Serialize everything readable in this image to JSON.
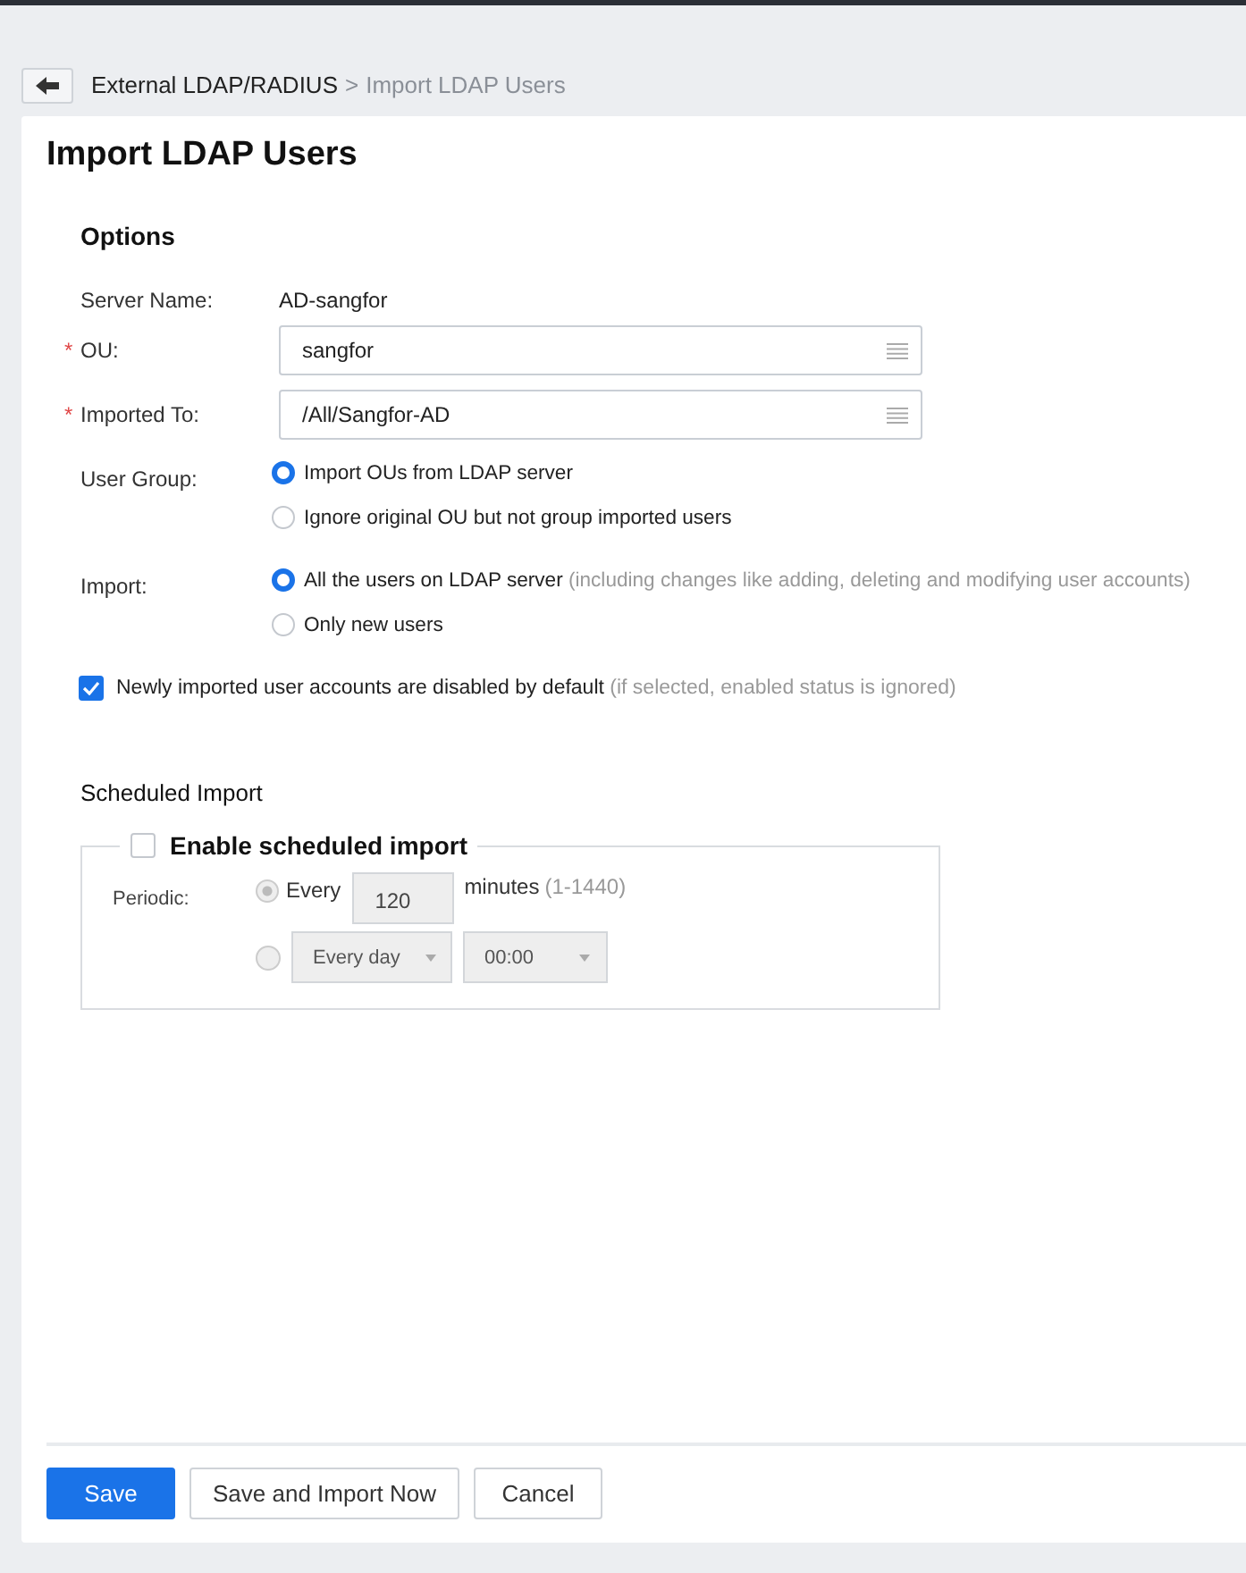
{
  "breadcrumb": {
    "parent": "External LDAP/RADIUS",
    "separator": ">",
    "current": "Import LDAP Users"
  },
  "title": "Import LDAP Users",
  "options": {
    "heading": "Options",
    "rows": [
      {
        "kind": "text",
        "label": "Server Name:",
        "value": "AD-sangfor"
      },
      {
        "kind": "picker",
        "label": "OU:",
        "required_mark": "*",
        "value": "sangfor"
      },
      {
        "kind": "picker",
        "label": "Imported To:",
        "required_mark": "*",
        "value": "/All/Sangfor-AD"
      },
      {
        "kind": "radio",
        "label": "User Group:",
        "options": [
          {
            "label": "Import OUs from LDAP server",
            "selected": true
          },
          {
            "label": "Ignore original OU but not group imported users",
            "selected": false
          }
        ]
      },
      {
        "kind": "radio",
        "label": "Import:",
        "options": [
          {
            "label": "All the users on LDAP server",
            "note": "(including changes like adding, deleting and modifying user accounts)",
            "selected": true
          },
          {
            "label": "Only new users",
            "selected": false
          }
        ]
      }
    ],
    "checkbox": {
      "label": "Newly imported user accounts are disabled by default",
      "note": "(if selected, enabled status is ignored)",
      "checked": true
    }
  },
  "scheduled": {
    "heading": "Scheduled Import",
    "enable": {
      "label": "Enable scheduled import",
      "checked": false
    },
    "disabled": true,
    "periodic_label": "Periodic:",
    "every": {
      "selected": true,
      "label": "Every",
      "value": "120",
      "unit": "minutes",
      "range": "(1-1440)"
    },
    "daily": {
      "selected": false,
      "frequency": "Every day",
      "time": "00:00"
    }
  },
  "buttons": [
    {
      "label": "Save",
      "kind": "primary"
    },
    {
      "label": "Save and Import Now",
      "kind": "default"
    },
    {
      "label": "Cancel",
      "kind": "default"
    }
  ]
}
